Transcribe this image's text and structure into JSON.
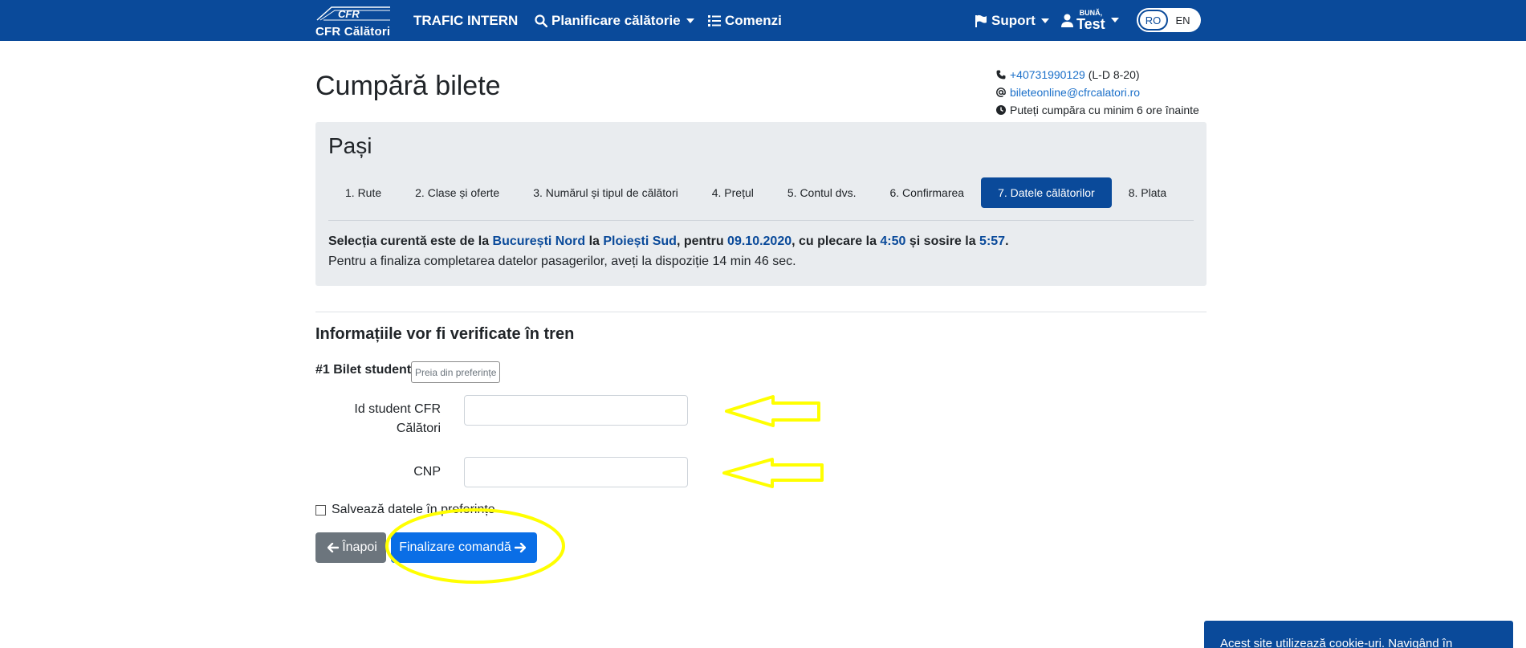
{
  "navbar": {
    "logo_emblem": "CFR",
    "logo_text": "CFR Călători",
    "trafic": "TRAFIC INTERN",
    "planificare": "Planificare călătorie",
    "comenzi": "Comenzi",
    "suport": "Suport",
    "user_greeting": "BUNĂ,",
    "user_name": "Test",
    "lang_ro": "RO",
    "lang_en": "EN",
    "color": "#0a4a9a"
  },
  "contact": {
    "phone": "+40731990129",
    "phone_hours": " (L-D 8-20)",
    "email": "bileteonline@cfrcalatori.ro",
    "notice": "Puteți cumpăra cu minim 6 ore înainte"
  },
  "page": {
    "title": "Cumpără bilete"
  },
  "steps": {
    "title": "Pași",
    "items": [
      {
        "label": "1. Rute",
        "active": false
      },
      {
        "label": "2. Clase și oferte",
        "active": false
      },
      {
        "label": "3. Numărul și tipul de călători",
        "active": false
      },
      {
        "label": "4. Prețul",
        "active": false
      },
      {
        "label": "5. Contul dvs.",
        "active": false
      },
      {
        "label": "6. Confirmarea",
        "active": false
      },
      {
        "label": "7. Datele călătorilor",
        "active": true
      },
      {
        "label": "8. Plata",
        "active": false
      }
    ],
    "selection": {
      "prefix": "Selecția curentă este de la ",
      "from": "București Nord",
      "to_word": " la ",
      "to": "Ploiești Sud",
      "date_word": ", pentru ",
      "date": "09.10.2020",
      "depart_word": ", cu plecare la ",
      "depart": "4:50",
      "arrive_word": " și sosire la ",
      "arrive": "5:57",
      "end": "."
    },
    "timer_text": "Pentru a finaliza completarea datelor pasagerilor, aveți la dispoziție 14 min 46 sec."
  },
  "form": {
    "section_title": "Informațiile vor fi verificate în tren",
    "ticket_label": "#1 Bilet student",
    "pref_button": "Preia din preferințe",
    "student_id_label_1": "Id student CFR",
    "student_id_label_2": "Călători",
    "student_id_value": "",
    "cnp_label": "CNP",
    "cnp_value": "",
    "save_label": "Salvează datele în preferințe",
    "back_button": "Înapoi",
    "finish_button": "Finalizare comandă"
  },
  "cookie": {
    "text": "Acest site utilizează cookie-uri. Navigând în"
  },
  "colors": {
    "primary_dark": "#0a4a9a",
    "primary_button": "#0a6ee6",
    "secondary_button": "#6c757d",
    "annotation_yellow": "#ffff00"
  }
}
